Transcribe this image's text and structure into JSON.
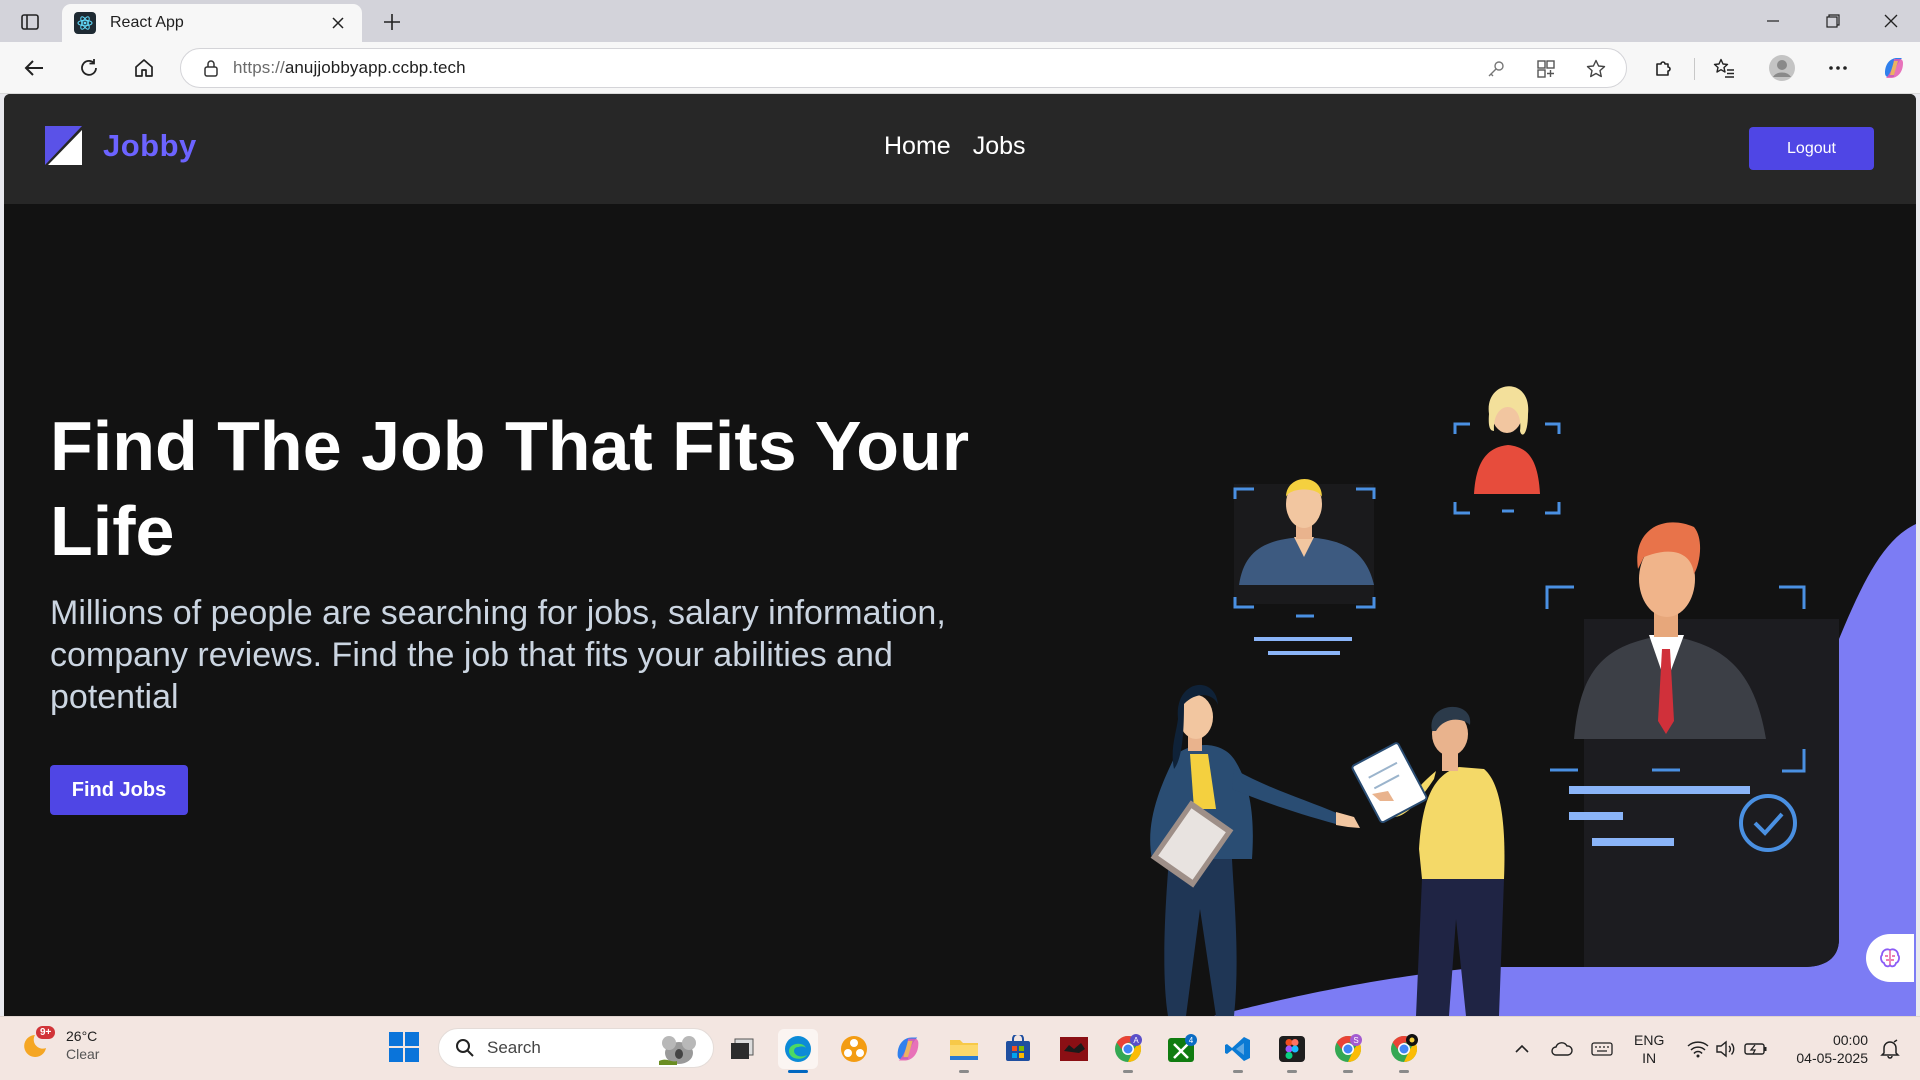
{
  "browser": {
    "tab_title": "React App",
    "url_protocol": "https://",
    "url_host": "anujjobbyapp.ccbp.tech"
  },
  "navbar": {
    "logo_text": "Jobby",
    "links": [
      "Home",
      "Jobs"
    ],
    "logout_label": "Logout"
  },
  "hero": {
    "title": "Find The Job That Fits Your Life",
    "description": "Millions of people are searching for jobs, salary information, company reviews. Find the job that fits your abilities and potential",
    "cta_label": "Find Jobs"
  },
  "taskbar": {
    "weather_temp": "26°C",
    "weather_cond": "Clear",
    "weather_badge": "9+",
    "search_placeholder": "Search",
    "lang_line1": "ENG",
    "lang_line2": "IN",
    "time": "00:00",
    "date": "04-05-2025",
    "badges": {
      "chrome1": "A",
      "xbox": "4",
      "chrome2": "S"
    }
  },
  "colors": {
    "brand": "#4f46e5",
    "logo": "#6c63ff",
    "page_bg": "#121212",
    "navbar_bg": "#272727"
  }
}
